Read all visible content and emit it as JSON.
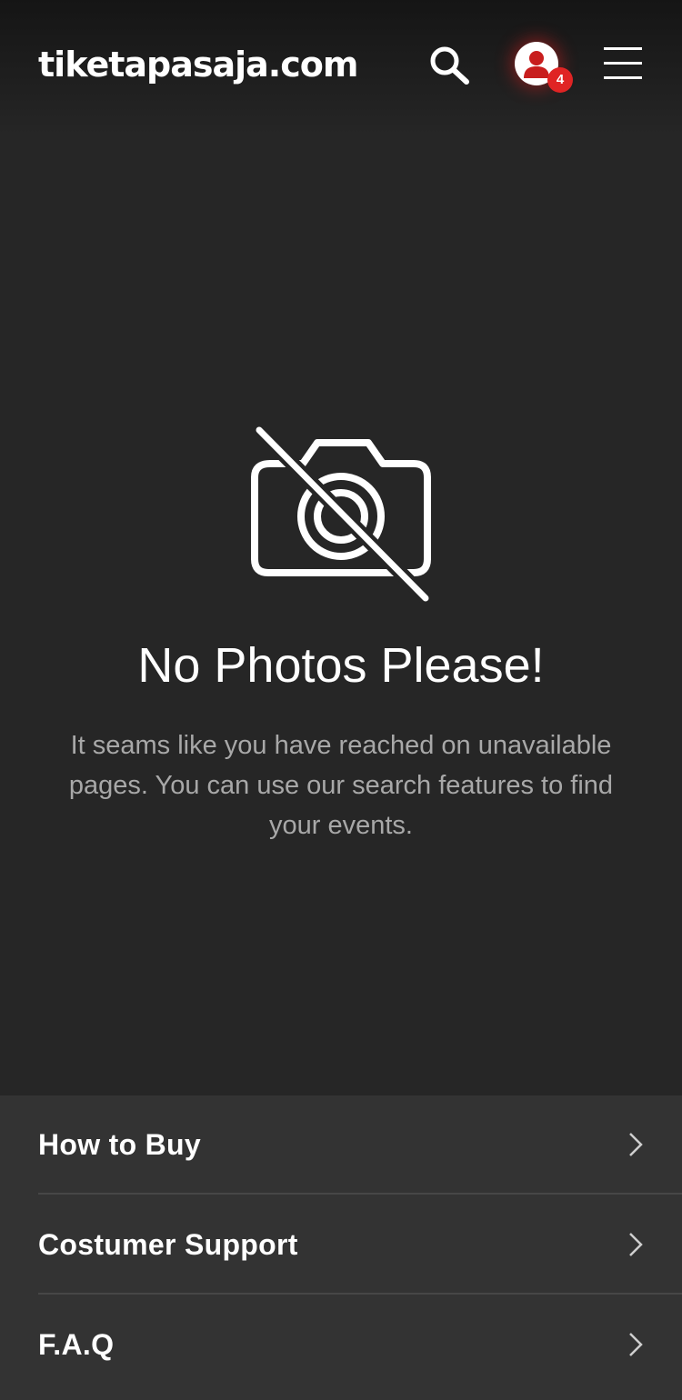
{
  "header": {
    "logo_text": "tiketapasaja.com",
    "notification_count": "4",
    "accent_color": "#e02424"
  },
  "icons": {
    "search": "search-icon",
    "avatar": "user-avatar-icon",
    "menu": "hamburger-menu-icon",
    "empty_state": "no-camera-icon",
    "chevron": "chevron-right-icon"
  },
  "empty_state": {
    "title": "No Photos Please!",
    "description": "It seams like you have reached on unavailable pages. You can use our search features to find your events."
  },
  "footer": {
    "items": [
      {
        "label": "How to Buy"
      },
      {
        "label": "Costumer Support"
      },
      {
        "label": "F.A.Q"
      }
    ]
  }
}
